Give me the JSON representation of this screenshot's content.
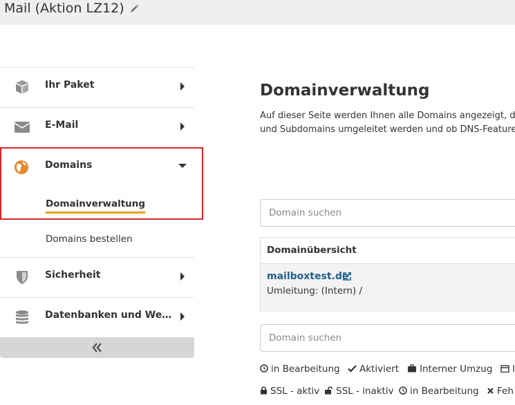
{
  "header": {
    "title": "Mail (Aktion LZ12)"
  },
  "sidebar": {
    "items": [
      {
        "label": "Ihr Paket",
        "icon": "box-icon"
      },
      {
        "label": "E-Mail",
        "icon": "envelope-icon"
      },
      {
        "label": "Domains",
        "icon": "globe-icon",
        "expanded": true
      },
      {
        "label": "Sicherheit",
        "icon": "shield-icon"
      },
      {
        "label": "Datenbanken und Webspace",
        "icon": "database-icon"
      }
    ],
    "domains_sub": [
      {
        "label": "Domainverwaltung",
        "active": true
      },
      {
        "label": "Domains bestellen",
        "active": false
      }
    ],
    "active_color": "#d9252a",
    "underline_color": "#e3a21a"
  },
  "main": {
    "title": "Domainverwaltung",
    "desc_line1": "Auf dieser Seite werden Ihnen alle Domains angezeigt, di",
    "desc_line2": "und Subdomains umgeleitet werden und ob DNS-Feature",
    "search_placeholder": "Domain suchen",
    "overview_header": "Domainübersicht",
    "domain": "mailboxtest.de",
    "redirect": "Umleitung: (Intern) /",
    "link_color": "#1f5f8b"
  },
  "legend": {
    "row1": [
      {
        "icon": "clock-icon",
        "label": "in Bearbeitung"
      },
      {
        "icon": "check-icon",
        "label": "Aktiviert"
      },
      {
        "icon": "suitcase-icon",
        "label": "Interner Umzug"
      },
      {
        "icon": "calendar-icon",
        "label": "I"
      }
    ],
    "row2": [
      {
        "icon": "lock-icon",
        "label": "SSL - aktiv"
      },
      {
        "icon": "unlock-icon",
        "label": "SSL - inaktiv"
      },
      {
        "icon": "clock-icon",
        "label": "in Bearbeitung"
      },
      {
        "icon": "times-icon",
        "label": "Feh"
      }
    ]
  }
}
